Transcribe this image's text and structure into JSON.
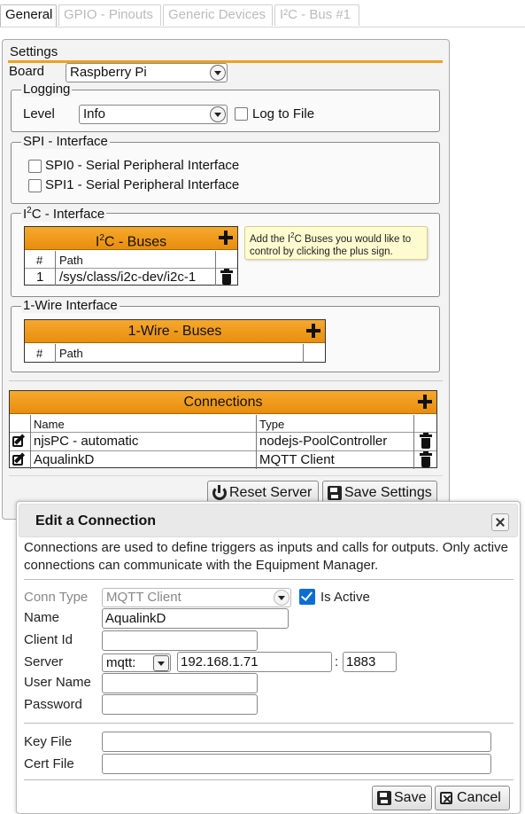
{
  "tabs": [
    "General",
    "GPIO - Pinouts",
    "Generic Devices",
    "I²C - Bus #1"
  ],
  "settings": {
    "title": "Settings",
    "board_label": "Board",
    "board_value": "Raspberry Pi",
    "logging": {
      "legend": "Logging",
      "level_label": "Level",
      "level_value": "Info",
      "log_to_file": "Log to File"
    },
    "spi": {
      "legend": "SPI - Interface",
      "spi0": "SPI0 - Serial Peripheral Interface",
      "spi1": "SPI1 - Serial Peripheral Interface"
    },
    "i2c": {
      "legend_prefix": "I",
      "legend_sup": "2",
      "legend_suffix": "C - Interface",
      "grid_title_prefix": "I",
      "grid_title_sup": "2",
      "grid_title_suffix": "C - Buses",
      "columns": [
        "#",
        "Path"
      ],
      "rows": [
        {
          "num": "1",
          "path": "/sys/class/i2c-dev/i2c-1"
        }
      ],
      "tooltip_a": "Add the I",
      "tooltip_sup": "2",
      "tooltip_b": "C Buses you would like to control by clicking the plus sign."
    },
    "onewire": {
      "legend": "1-Wire Interface",
      "grid_title": "1-Wire - Buses",
      "columns": [
        "#",
        "Path"
      ]
    },
    "connections": {
      "grid_title": "Connections",
      "columns": [
        "Name",
        "Type"
      ],
      "rows": [
        {
          "name": "njsPC - automatic",
          "type": "nodejs-PoolController"
        },
        {
          "name": "AqualinkD",
          "type": "MQTT Client"
        }
      ]
    },
    "buttons": {
      "reset": "Reset Server",
      "save": "Save Settings"
    }
  },
  "dialog": {
    "title": "Edit a Connection",
    "description": "Connections are used to define triggers as inputs and calls for outputs. Only active connections can communicate with the Equipment Manager.",
    "conn_type_label": "Conn Type",
    "conn_type_value": "MQTT Client",
    "is_active_label": "Is Active",
    "name_label": "Name",
    "name_value": "AqualinkD",
    "client_id_label": "Client Id",
    "client_id_value": "",
    "server_label": "Server",
    "protocol_value": "mqtt:",
    "host_value": "192.168.1.71",
    "port_sep": ":",
    "port_value": "1883",
    "username_label": "User Name",
    "username_value": "",
    "password_label": "Password",
    "password_value": "",
    "keyfile_label": "Key File",
    "keyfile_value": "",
    "certfile_label": "Cert File",
    "certfile_value": "",
    "save_button": "Save",
    "cancel_button": "Cancel"
  }
}
